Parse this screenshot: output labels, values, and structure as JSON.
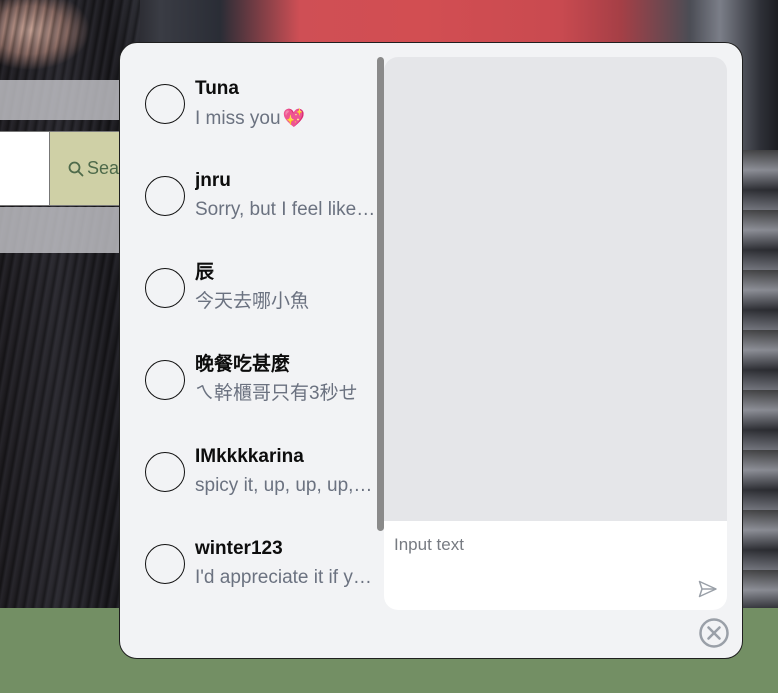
{
  "background": {
    "search_button_label": "Sea",
    "search_icon": "search-icon"
  },
  "chat": {
    "conversations": [
      {
        "name": "Tuna",
        "preview": "I miss you",
        "emoji": "💖"
      },
      {
        "name": "jnru",
        "preview": "Sorry, but I feel like we should stop",
        "emoji": ""
      },
      {
        "name": "辰",
        "preview": "今天去哪小魚",
        "emoji": ""
      },
      {
        "name": "晚餐吃甚麼",
        "preview": "ㄟ幹櫃哥只有3秒せ",
        "emoji": ""
      },
      {
        "name": "IMkkkkarina",
        "preview": "spicy it, up, up, up, up",
        "emoji": ""
      },
      {
        "name": "winter123",
        "preview": "I'd appreciate it if you could",
        "emoji": ""
      }
    ],
    "input": {
      "placeholder": "Input text",
      "value": ""
    },
    "send_icon": "send-icon",
    "close_icon": "close-circle-icon"
  },
  "colors": {
    "panel_bg": "#f2f3f5",
    "message_area_bg": "#e5e6e9",
    "page_bottom": "#738f64",
    "heart": "#e8335c"
  }
}
